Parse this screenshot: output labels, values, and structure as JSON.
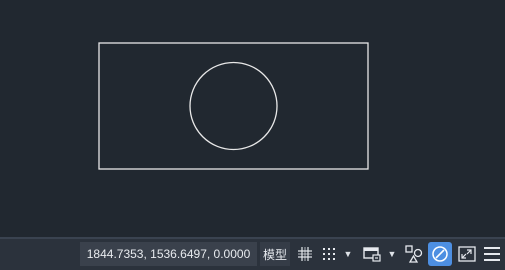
{
  "canvas": {
    "background": "#212830",
    "stroke_color": "#ffffff",
    "shapes": [
      {
        "type": "rectangle"
      },
      {
        "type": "circle"
      }
    ]
  },
  "statusbar": {
    "coordinates": "1844.7353, 1536.6497, 0.0000",
    "model_label": "模型",
    "icons": [
      "grid-icon",
      "snap-dots-icon",
      "dropdown-arrow-icon",
      "annotation-display-icon",
      "dropdown-arrow-icon",
      "object-snap-icon",
      "viewport-lock-icon",
      "fullscreen-icon",
      "menu-icon"
    ],
    "accent_color": "#4d8fe2"
  }
}
